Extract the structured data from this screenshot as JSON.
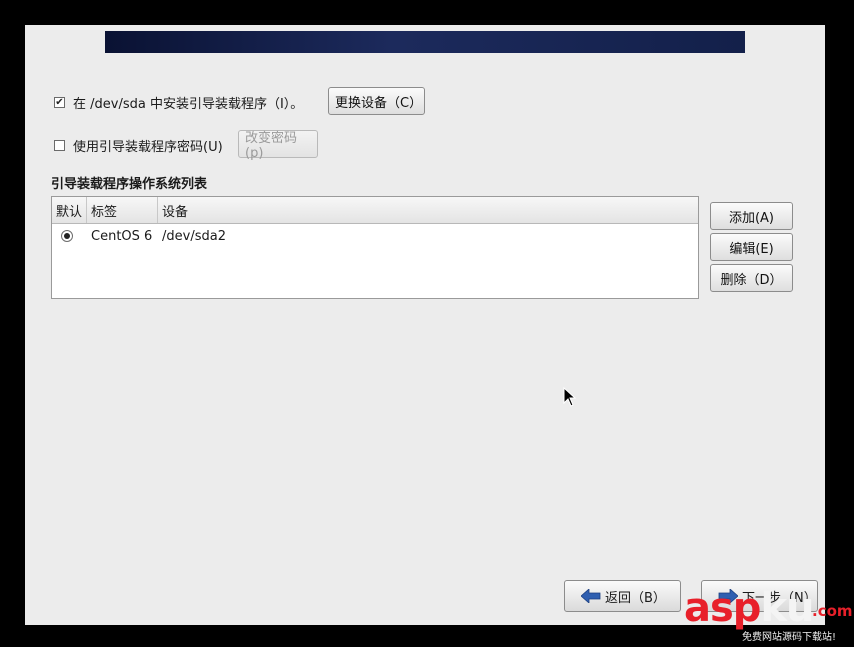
{
  "options": {
    "install_bootloader": {
      "checked": true,
      "label": "在 /dev/sda 中安装引导装载程序（I）。"
    },
    "change_device_label": "更换设备（C）",
    "use_password": {
      "checked": false,
      "label": "使用引导装载程序密码(U)"
    },
    "change_password_label": "改变密码(p)"
  },
  "os_list": {
    "title": "引导装载程序操作系统列表",
    "columns": [
      "默认",
      "标签",
      "设备"
    ],
    "rows": [
      {
        "default": true,
        "label": "CentOS 6",
        "device": "/dev/sda2"
      }
    ],
    "buttons": {
      "add": "添加(A)",
      "edit": "编辑(E)",
      "delete": "删除（D）"
    }
  },
  "nav": {
    "back": "返回（B）",
    "next": "下一步（N）"
  },
  "icons": {
    "back": "arrow-left-icon",
    "next": "arrow-right-icon",
    "cursor": "mouse-pointer-icon",
    "radio": "radio-selected-icon"
  },
  "watermark": {
    "brand_red": "asp",
    "brand_white": "ku",
    "tld": ".com",
    "tagline": "免费网站源码下载站!"
  },
  "colors": {
    "banner": "#13204a",
    "window_bg": "#ececec",
    "arrow": "#2f5fb0",
    "watermark_red": "#e8202a"
  }
}
